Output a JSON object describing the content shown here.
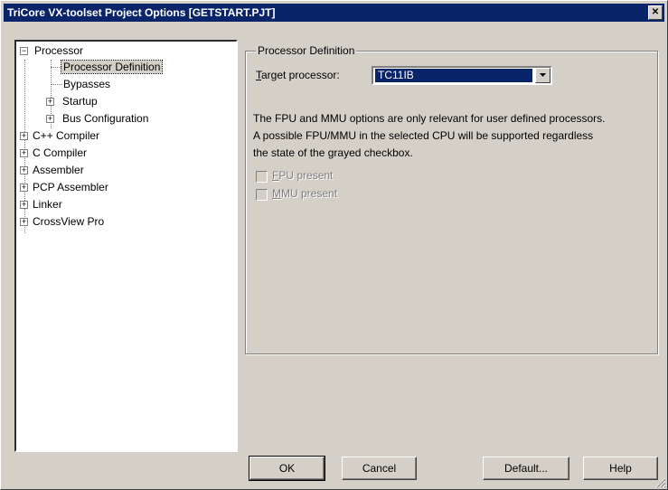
{
  "window": {
    "title": "TriCore VX-toolset Project Options [GETSTART.PJT]",
    "close_glyph": "✕"
  },
  "tree": {
    "items": [
      {
        "label": "Processor",
        "expander": "−"
      },
      {
        "label": "Processor Definition"
      },
      {
        "label": "Bypasses"
      },
      {
        "label": "Startup",
        "expander": "+"
      },
      {
        "label": "Bus Configuration",
        "expander": "+"
      },
      {
        "label": "C++ Compiler",
        "expander": "+"
      },
      {
        "label": "C Compiler",
        "expander": "+"
      },
      {
        "label": "Assembler",
        "expander": "+"
      },
      {
        "label": "PCP Assembler",
        "expander": "+"
      },
      {
        "label": "Linker",
        "expander": "+"
      },
      {
        "label": "CrossView Pro",
        "expander": "+"
      }
    ]
  },
  "panel": {
    "group_title": "Processor Definition",
    "target_label_first": "T",
    "target_label_rest": "arget processor:",
    "target_value": "TC11IB",
    "description_lines": [
      "The FPU and MMU options are only relevant for user defined processors.",
      "A possible FPU/MMU in the selected CPU will be supported regardless",
      "the state of the grayed checkbox."
    ],
    "fpu_first": "F",
    "fpu_rest": "PU present",
    "mmu_first": "M",
    "mmu_rest": "MU present"
  },
  "buttons": {
    "ok": "OK",
    "cancel": "Cancel",
    "default": "Default...",
    "help": "Help"
  }
}
